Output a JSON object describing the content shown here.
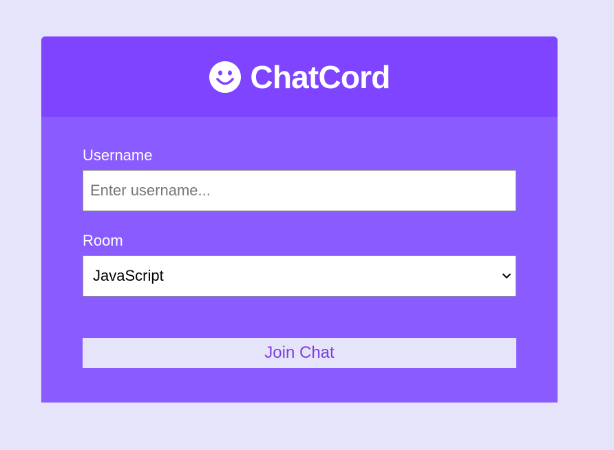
{
  "header": {
    "icon": "smile-icon",
    "title": "ChatCord"
  },
  "form": {
    "username_label": "Username",
    "username_placeholder": "Enter username...",
    "username_value": "",
    "room_label": "Room",
    "room_selected": "JavaScript",
    "submit_label": "Join Chat"
  },
  "colors": {
    "page_bg": "#e6e4fb",
    "header_bg": "#7f44ff",
    "main_bg": "#8a5cff",
    "button_text": "#7b3fe0"
  }
}
